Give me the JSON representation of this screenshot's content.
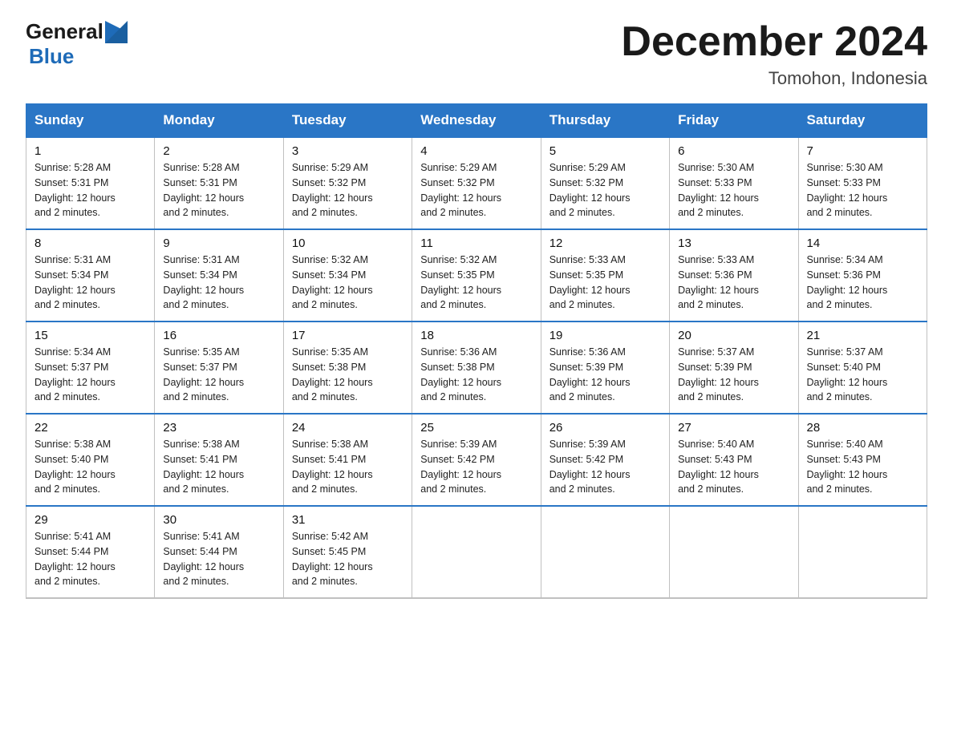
{
  "header": {
    "logo_general": "General",
    "logo_blue": "Blue",
    "title": "December 2024",
    "subtitle": "Tomohon, Indonesia"
  },
  "days_of_week": [
    "Sunday",
    "Monday",
    "Tuesday",
    "Wednesday",
    "Thursday",
    "Friday",
    "Saturday"
  ],
  "weeks": [
    [
      {
        "day": "1",
        "sunrise": "5:28 AM",
        "sunset": "5:31 PM",
        "daylight": "12 hours and 2 minutes."
      },
      {
        "day": "2",
        "sunrise": "5:28 AM",
        "sunset": "5:31 PM",
        "daylight": "12 hours and 2 minutes."
      },
      {
        "day": "3",
        "sunrise": "5:29 AM",
        "sunset": "5:32 PM",
        "daylight": "12 hours and 2 minutes."
      },
      {
        "day": "4",
        "sunrise": "5:29 AM",
        "sunset": "5:32 PM",
        "daylight": "12 hours and 2 minutes."
      },
      {
        "day": "5",
        "sunrise": "5:29 AM",
        "sunset": "5:32 PM",
        "daylight": "12 hours and 2 minutes."
      },
      {
        "day": "6",
        "sunrise": "5:30 AM",
        "sunset": "5:33 PM",
        "daylight": "12 hours and 2 minutes."
      },
      {
        "day": "7",
        "sunrise": "5:30 AM",
        "sunset": "5:33 PM",
        "daylight": "12 hours and 2 minutes."
      }
    ],
    [
      {
        "day": "8",
        "sunrise": "5:31 AM",
        "sunset": "5:34 PM",
        "daylight": "12 hours and 2 minutes."
      },
      {
        "day": "9",
        "sunrise": "5:31 AM",
        "sunset": "5:34 PM",
        "daylight": "12 hours and 2 minutes."
      },
      {
        "day": "10",
        "sunrise": "5:32 AM",
        "sunset": "5:34 PM",
        "daylight": "12 hours and 2 minutes."
      },
      {
        "day": "11",
        "sunrise": "5:32 AM",
        "sunset": "5:35 PM",
        "daylight": "12 hours and 2 minutes."
      },
      {
        "day": "12",
        "sunrise": "5:33 AM",
        "sunset": "5:35 PM",
        "daylight": "12 hours and 2 minutes."
      },
      {
        "day": "13",
        "sunrise": "5:33 AM",
        "sunset": "5:36 PM",
        "daylight": "12 hours and 2 minutes."
      },
      {
        "day": "14",
        "sunrise": "5:34 AM",
        "sunset": "5:36 PM",
        "daylight": "12 hours and 2 minutes."
      }
    ],
    [
      {
        "day": "15",
        "sunrise": "5:34 AM",
        "sunset": "5:37 PM",
        "daylight": "12 hours and 2 minutes."
      },
      {
        "day": "16",
        "sunrise": "5:35 AM",
        "sunset": "5:37 PM",
        "daylight": "12 hours and 2 minutes."
      },
      {
        "day": "17",
        "sunrise": "5:35 AM",
        "sunset": "5:38 PM",
        "daylight": "12 hours and 2 minutes."
      },
      {
        "day": "18",
        "sunrise": "5:36 AM",
        "sunset": "5:38 PM",
        "daylight": "12 hours and 2 minutes."
      },
      {
        "day": "19",
        "sunrise": "5:36 AM",
        "sunset": "5:39 PM",
        "daylight": "12 hours and 2 minutes."
      },
      {
        "day": "20",
        "sunrise": "5:37 AM",
        "sunset": "5:39 PM",
        "daylight": "12 hours and 2 minutes."
      },
      {
        "day": "21",
        "sunrise": "5:37 AM",
        "sunset": "5:40 PM",
        "daylight": "12 hours and 2 minutes."
      }
    ],
    [
      {
        "day": "22",
        "sunrise": "5:38 AM",
        "sunset": "5:40 PM",
        "daylight": "12 hours and 2 minutes."
      },
      {
        "day": "23",
        "sunrise": "5:38 AM",
        "sunset": "5:41 PM",
        "daylight": "12 hours and 2 minutes."
      },
      {
        "day": "24",
        "sunrise": "5:38 AM",
        "sunset": "5:41 PM",
        "daylight": "12 hours and 2 minutes."
      },
      {
        "day": "25",
        "sunrise": "5:39 AM",
        "sunset": "5:42 PM",
        "daylight": "12 hours and 2 minutes."
      },
      {
        "day": "26",
        "sunrise": "5:39 AM",
        "sunset": "5:42 PM",
        "daylight": "12 hours and 2 minutes."
      },
      {
        "day": "27",
        "sunrise": "5:40 AM",
        "sunset": "5:43 PM",
        "daylight": "12 hours and 2 minutes."
      },
      {
        "day": "28",
        "sunrise": "5:40 AM",
        "sunset": "5:43 PM",
        "daylight": "12 hours and 2 minutes."
      }
    ],
    [
      {
        "day": "29",
        "sunrise": "5:41 AM",
        "sunset": "5:44 PM",
        "daylight": "12 hours and 2 minutes."
      },
      {
        "day": "30",
        "sunrise": "5:41 AM",
        "sunset": "5:44 PM",
        "daylight": "12 hours and 2 minutes."
      },
      {
        "day": "31",
        "sunrise": "5:42 AM",
        "sunset": "5:45 PM",
        "daylight": "12 hours and 2 minutes."
      },
      null,
      null,
      null,
      null
    ]
  ],
  "labels": {
    "sunrise": "Sunrise:",
    "sunset": "Sunset:",
    "daylight": "Daylight:"
  }
}
